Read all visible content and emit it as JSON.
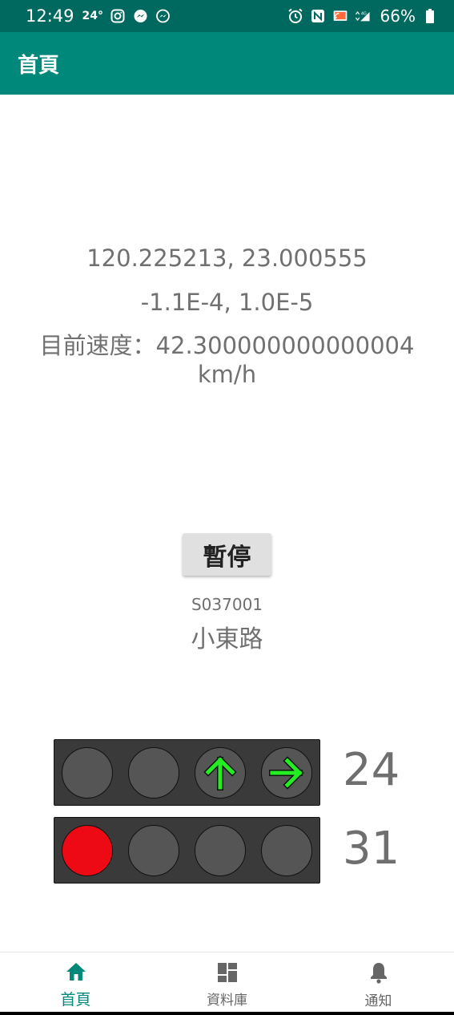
{
  "statusbar": {
    "time": "12:49",
    "temp": "24°",
    "battery": "66%"
  },
  "appbar": {
    "title": "首頁"
  },
  "info": {
    "coords": "120.225213, 23.000555",
    "delta": "-1.1E-4, 1.0E-5",
    "speed": "目前速度：42.300000000000004 km/h"
  },
  "controls": {
    "pause_label": "暫停"
  },
  "station": {
    "code": "S037001",
    "road": "小東路"
  },
  "signals": [
    {
      "lamps": [
        "off",
        "off",
        "green-arrow-up",
        "green-arrow-right"
      ],
      "countdown": "24"
    },
    {
      "lamps": [
        "red",
        "off",
        "off",
        "off"
      ],
      "countdown": "31"
    }
  ],
  "colors": {
    "primary": "#00897b",
    "primary_dark": "#00695f",
    "red_lamp": "#ee0a14",
    "arrow_green": "#22ee22"
  },
  "nav": {
    "items": [
      {
        "label": "首頁",
        "icon": "home-icon",
        "active": true
      },
      {
        "label": "資料庫",
        "icon": "dashboard-icon",
        "active": false
      },
      {
        "label": "通知",
        "icon": "bell-icon",
        "active": false
      }
    ]
  }
}
